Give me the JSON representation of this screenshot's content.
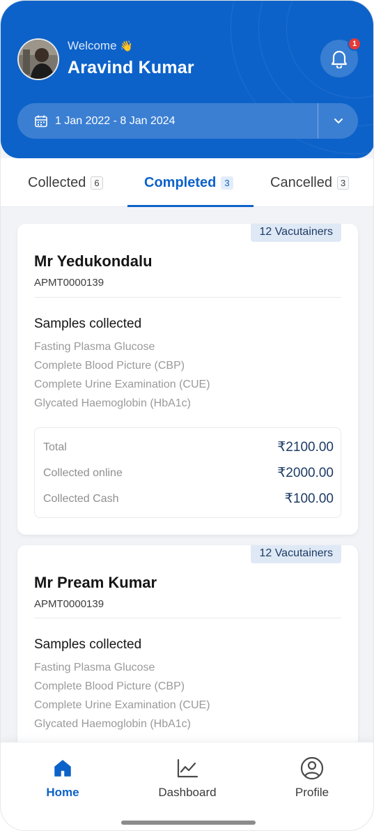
{
  "header": {
    "welcome": "Welcome",
    "wave": "👋",
    "user_name": "Aravind Kumar",
    "notification_count": "1",
    "date_range": "1 Jan 2022 - 8 Jan 2024",
    "bg_color": "#0d62c9"
  },
  "tabs": [
    {
      "label": "Collected",
      "count": "6"
    },
    {
      "label": "Completed",
      "count": "3",
      "active": true
    },
    {
      "label": "Cancelled",
      "count": "3"
    }
  ],
  "cards": [
    {
      "vacutainers": "12 Vacutainers",
      "name": "Mr Yedukondalu",
      "appointment_id": "APMT0000139",
      "samples_title": "Samples collected",
      "samples": [
        "Fasting Plasma Glucose",
        "Complete Blood Picture (CBP)",
        "Complete Urine Examination (CUE)",
        "Glycated Haemoglobin (HbA1c)"
      ],
      "amounts": [
        {
          "label": "Total",
          "value": "₹2100.00"
        },
        {
          "label": "Collected online",
          "value": "₹2000.00"
        },
        {
          "label": "Collected Cash",
          "value": "₹100.00"
        }
      ]
    },
    {
      "vacutainers": "12 Vacutainers",
      "name": "Mr Pream Kumar",
      "appointment_id": "APMT0000139",
      "samples_title": "Samples collected",
      "samples": [
        "Fasting Plasma Glucose",
        "Complete Blood Picture (CBP)",
        "Complete Urine Examination (CUE)",
        "Glycated Haemoglobin (HbA1c)"
      ]
    }
  ],
  "nav": {
    "home": "Home",
    "dashboard": "Dashboard",
    "profile": "Profile",
    "icons": [
      "home-icon",
      "chart-line-icon",
      "user-circle-icon"
    ]
  }
}
